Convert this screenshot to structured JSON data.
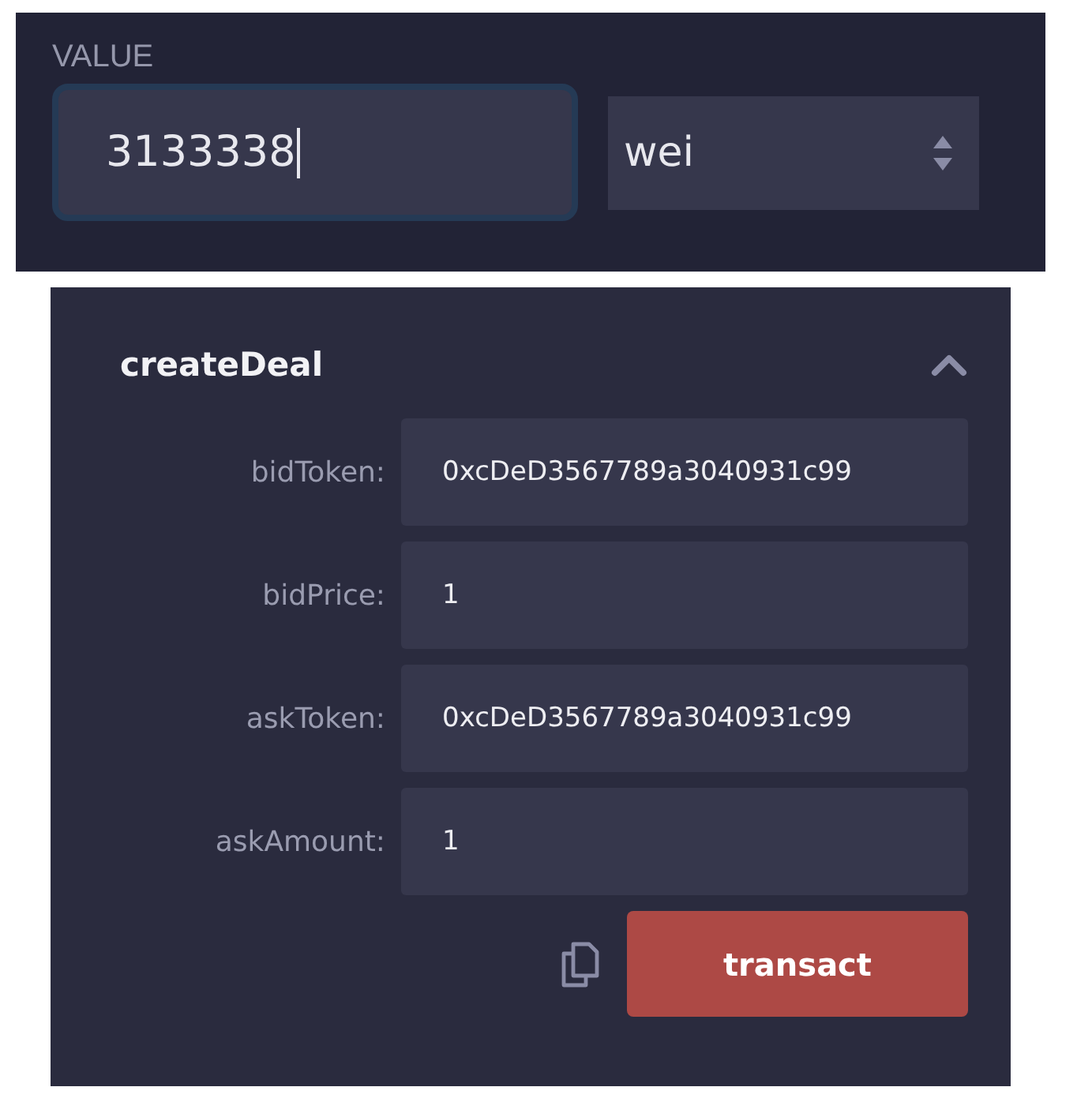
{
  "value_panel": {
    "label": "VALUE",
    "value": "3133338",
    "focused": true,
    "unit": "wei"
  },
  "function_panel": {
    "title": "createDeal",
    "expanded": true,
    "params": [
      {
        "label": "bidToken:",
        "value": "0xcDeD3567789a3040931c99"
      },
      {
        "label": "bidPrice:",
        "value": "1"
      },
      {
        "label": "askToken:",
        "value": "0xcDeD3567789a3040931c99"
      },
      {
        "label": "askAmount:",
        "value": "1"
      }
    ],
    "button": "transact"
  }
}
